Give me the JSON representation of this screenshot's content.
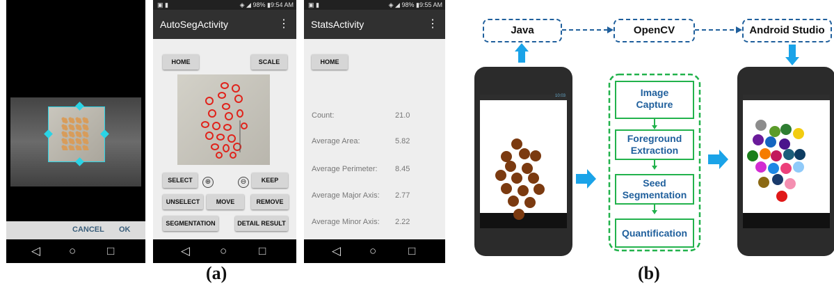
{
  "crop_screen": {
    "cancel_label": "CANCEL",
    "ok_label": "OK"
  },
  "autoseg": {
    "status_time": "9:54 AM",
    "status_battery": "98%",
    "title": "AutoSegActivity",
    "home_label": "HOME",
    "scale_label": "SCALE",
    "select_label": "SELECT",
    "keep_label": "KEEP",
    "unselect_label": "UNSELECT",
    "move_label": "MOVE",
    "remove_label": "REMOVE",
    "segmentation_label": "SEGMENTATION",
    "detail_label": "DETAIL RESULT"
  },
  "stats": {
    "status_time": "9:55 AM",
    "status_battery": "98%",
    "title": "StatsActivity",
    "home_label": "HOME",
    "rows": [
      {
        "label": "Count:",
        "value": "21.0"
      },
      {
        "label": "Average Area:",
        "value": "5.82"
      },
      {
        "label": "Average Perimeter:",
        "value": "8.45"
      },
      {
        "label": "Average Major Axis:",
        "value": "2.77"
      },
      {
        "label": "Average Minor Axis:",
        "value": "2.22"
      }
    ]
  },
  "diagram": {
    "java": "Java",
    "opencv": "OpenCV",
    "android_studio": "Android Studio",
    "steps": [
      "Image\nCapture",
      "Foreground\nExtraction",
      "Seed\nSegmentation",
      "Quantification"
    ],
    "phone_time": "10:03",
    "accent_blue": "#1aa3e8",
    "box_blue": "#1f5f9c",
    "step_green": "#22b24c",
    "seed_brown": "#7b3a10"
  },
  "captions": {
    "a": "(a)",
    "b": "(b)"
  }
}
